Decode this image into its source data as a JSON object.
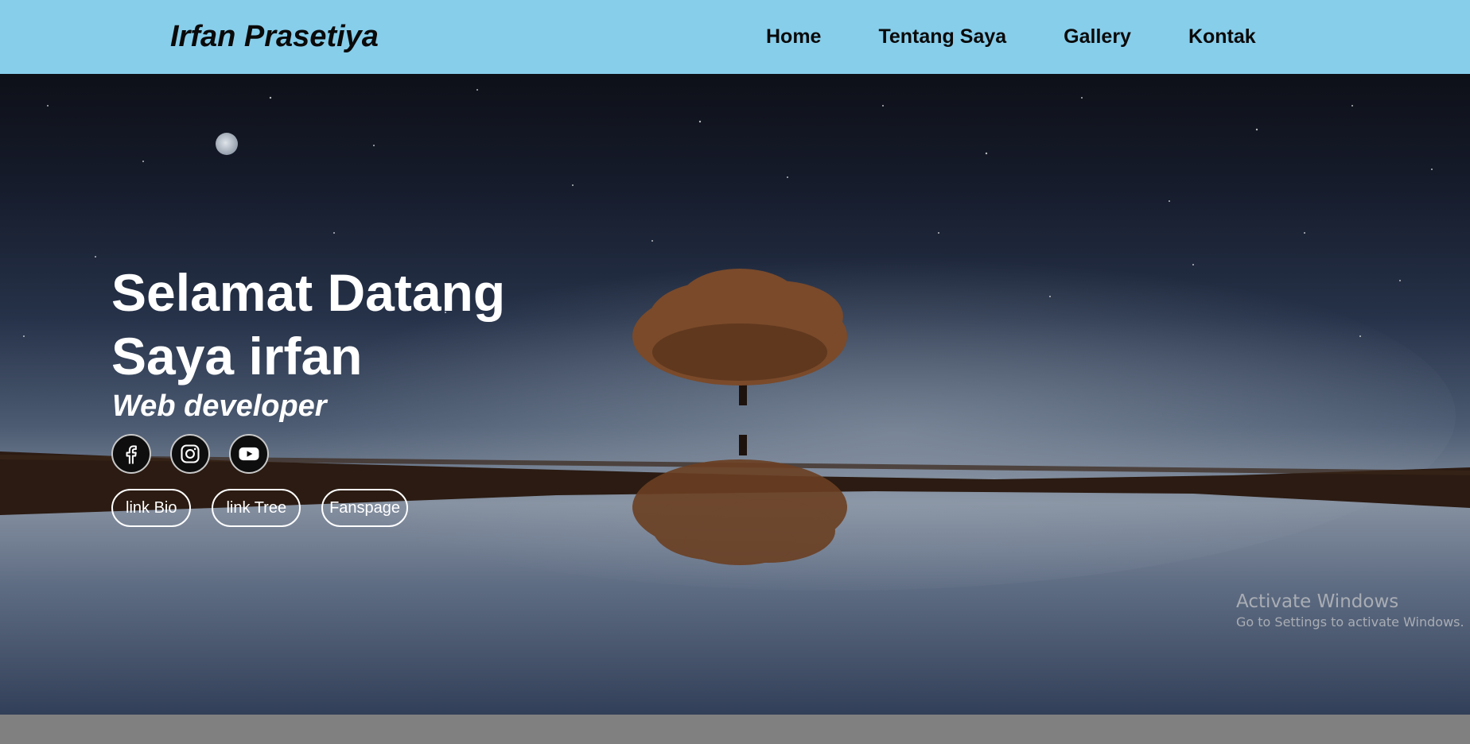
{
  "header": {
    "brand": "Irfan Prasetiya",
    "nav": [
      "Home",
      "Tentang Saya",
      "Gallery",
      "Kontak"
    ]
  },
  "hero": {
    "greeting_line1": "Selamat Datang",
    "greeting_line2": "Saya irfan",
    "role": "Web developer",
    "social_icons": [
      "facebook-icon",
      "instagram-icon",
      "youtube-icon"
    ],
    "links": [
      "link Bio",
      "link Tree",
      "Fanspage"
    ]
  },
  "watermark": {
    "title": "Activate Windows",
    "subtitle": "Go to Settings to activate Windows."
  },
  "colors": {
    "navbar": "#87ceeb",
    "text_dark": "#0a0a0a",
    "hero_text": "#ffffff",
    "footer_bar": "#808080"
  }
}
